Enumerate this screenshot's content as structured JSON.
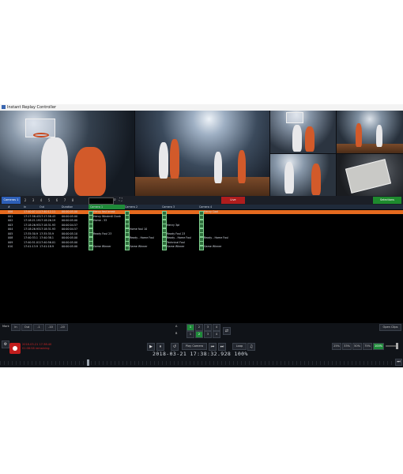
{
  "window": {
    "title": "Instant Replay Controller"
  },
  "toolbar": {
    "camera_select": "Cameras 1",
    "nav": [
      "2",
      "3",
      "4",
      "5",
      "6",
      "7",
      "8"
    ],
    "live_label": "Live",
    "selections_label": "Selections"
  },
  "grid": {
    "headers": [
      "#",
      "In",
      "Out",
      "Duration",
      "Camera 1",
      "Camera 2",
      "Camera 3",
      "Camera 4"
    ],
    "rows": [
      {
        "num": "006",
        "in": "17:40:07.11",
        "out": "17:40:12.11",
        "dur": "00:00:05.00",
        "c1": "Henry fast break",
        "c2": "",
        "c3": "",
        "c4": "Henry Cool",
        "hl": true
      },
      {
        "num": "001",
        "in": "17:17:58.43",
        "out": "17:17:58.43",
        "dur": "00:00:05.00",
        "c1": "Henry Windmill Dunk",
        "c2": "",
        "c3": "",
        "c4": "",
        "hl": false
      },
      {
        "num": "002",
        "in": "17:18:21.19",
        "out": "17:18:26.19",
        "dur": "00:00:05.00",
        "c1": "Home - 33",
        "c2": "",
        "c3": "",
        "c4": "",
        "hl": false
      },
      {
        "num": "003",
        "in": "17:18:26.93",
        "out": "17:18:31.93",
        "dur": "00:00:04.57",
        "c1": "",
        "c2": "",
        "c3": "Henry 3pt",
        "c4": "",
        "hl": false
      },
      {
        "num": "004",
        "in": "17:18:26.93",
        "out": "17:18:31.93",
        "dur": "00:00:04.57",
        "c1": "",
        "c2": "Home foul 10",
        "c3": "",
        "c4": "",
        "hl": false
      },
      {
        "num": "005",
        "in": "17:35:30.9",
        "out": "17:35:35.9",
        "dur": "00:00:05.10",
        "c1": "Ready Foul 23",
        "c2": "",
        "c3": "Ready Foul 23",
        "c4": "",
        "hl": false
      },
      {
        "num": "008",
        "in": "17:40:33.1",
        "out": "17:40:38.1",
        "dur": "00:00:05.00",
        "c1": "",
        "c2": "Ready - Home Foul",
        "c3": "Ready - Home Foul",
        "c4": "Ready - Home Foul",
        "hl": false
      },
      {
        "num": "009",
        "in": "17:40:51.01",
        "out": "17:40:56.01",
        "dur": "00:00:05.00",
        "c1": "",
        "c2": "",
        "c3": "Technical Foul",
        "c4": "",
        "hl": false
      },
      {
        "num": "010",
        "in": "17:41:13.9",
        "out": "17:41:18.9",
        "dur": "00:00:05.00",
        "c1": "Game Winner",
        "c2": "Game Winner",
        "c3": "Game Winner",
        "c4": "Game Winner",
        "hl": false
      }
    ]
  },
  "controls": {
    "mark_label": "Mark",
    "in_label": "In",
    "out_label": "Out",
    "offsets": [
      "-1",
      "-10",
      "-20"
    ],
    "open_clips": "Open Clips",
    "rec_line1": "2018-03-21 17:38:40",
    "rec_line2": "01:08:58 remaining",
    "play_camera": "Play Camera",
    "loop_label": "Loop",
    "cam_a_label": "A",
    "cam_b_label": "B",
    "cam_nums_top": [
      "1",
      "2",
      "3",
      "4"
    ],
    "cam_nums_bottom": [
      "1",
      "2",
      "3",
      "4"
    ],
    "speeds": [
      "25%",
      "33%",
      "50%",
      "75%",
      "100%"
    ],
    "timecode": "2018-03-21  17:38:32.928   100%"
  },
  "colors": {
    "accent": "#2d5fb7",
    "live": "#b01d1d",
    "selected_row": "#e56a1f",
    "green": "#1f8a3a"
  }
}
